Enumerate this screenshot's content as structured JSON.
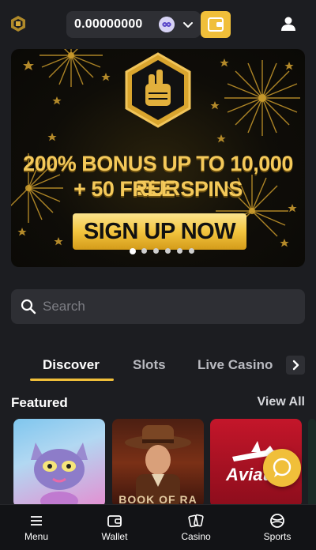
{
  "header": {
    "logo": "brand-logo",
    "balance": "0.00000000",
    "currency_icon": "crypto-coin-icon",
    "wallet_icon": "wallet-icon",
    "user_icon": "user-icon",
    "accent": "#f0bf3a"
  },
  "banner": {
    "promo_line1": "200% BONUS UP TO 10,000 EUR",
    "promo_line2": "+ 50 FREE SPINS",
    "cta": "SIGN UP NOW",
    "slides_count": 6,
    "active_slide": 1
  },
  "search": {
    "placeholder": "Search",
    "value": ""
  },
  "tabs": [
    {
      "label": "Discover",
      "active": true
    },
    {
      "label": "Slots",
      "active": false
    },
    {
      "label": "Live Casino",
      "active": false
    }
  ],
  "featured": {
    "title": "Featured",
    "view_all": "View All",
    "games": [
      {
        "label": ""
      },
      {
        "label": "BOOK OF RA"
      },
      {
        "label": "Aviator"
      }
    ]
  },
  "bottom_nav": [
    {
      "label": "Menu",
      "icon": "menu-icon"
    },
    {
      "label": "Wallet",
      "icon": "wallet-icon"
    },
    {
      "label": "Casino",
      "icon": "cards-icon"
    },
    {
      "label": "Sports",
      "icon": "ball-icon"
    }
  ]
}
